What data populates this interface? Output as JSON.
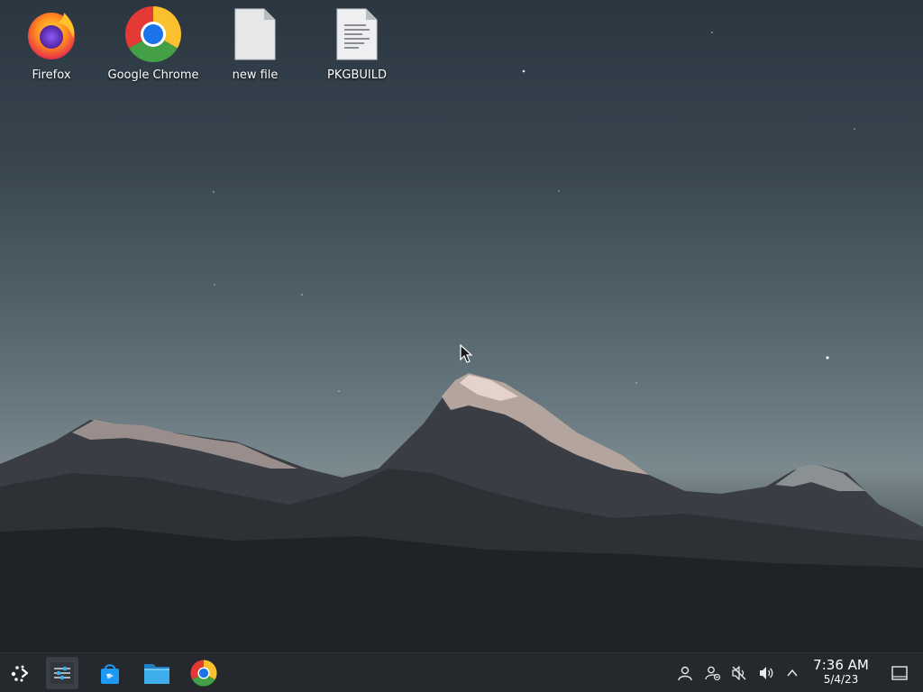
{
  "desktop": {
    "icons": [
      {
        "label": "Firefox",
        "icon": "firefox-icon"
      },
      {
        "label": "Google Chrome",
        "icon": "chrome-icon"
      },
      {
        "label": "new file",
        "icon": "blank-file-icon"
      },
      {
        "label": "PKGBUILD",
        "icon": "text-file-icon"
      }
    ]
  },
  "taskbar": {
    "launchers": [
      {
        "name": "application-launcher",
        "icon": "kde-launcher-icon"
      },
      {
        "name": "system-settings",
        "icon": "settings-sliders-icon"
      },
      {
        "name": "discover",
        "icon": "store-bag-icon"
      },
      {
        "name": "dolphin",
        "icon": "folder-icon"
      },
      {
        "name": "google-chrome",
        "icon": "chrome-icon"
      }
    ],
    "tray": [
      "user-icon",
      "network-icon",
      "muted-speaker-icon",
      "volume-icon",
      "chevron-up-icon"
    ],
    "clock": {
      "time": "7:36 AM",
      "date": "5/4/23"
    }
  },
  "colors": {
    "taskbar_bg": "#25292e",
    "sky_top": "#2b3641",
    "sky_horizon": "#7b8a8f"
  }
}
